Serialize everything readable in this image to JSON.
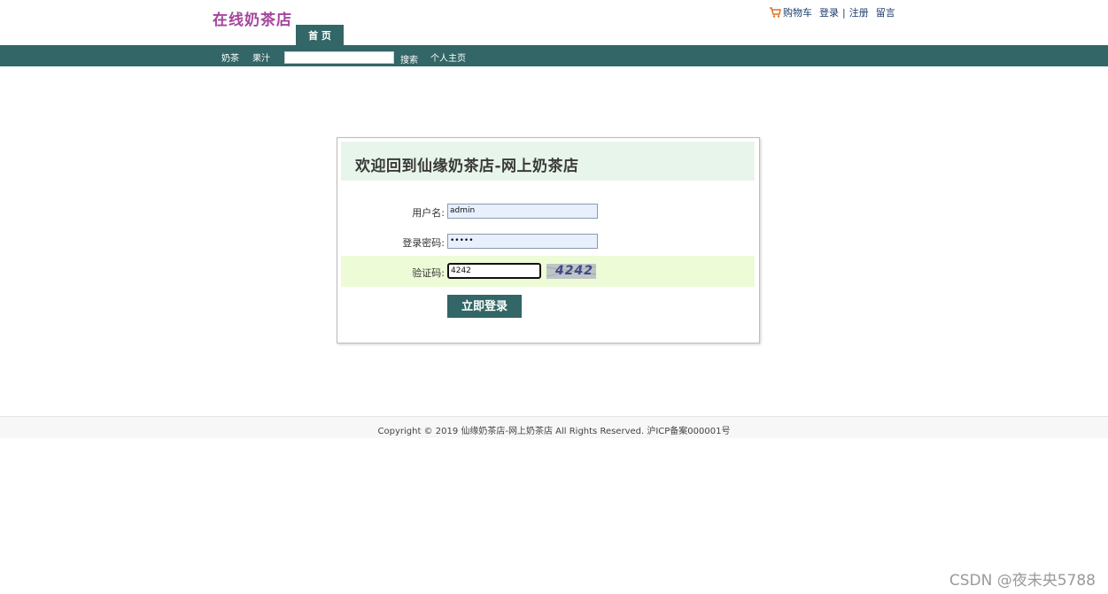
{
  "header": {
    "logo": "在线奶茶店",
    "links": {
      "cart": "购物车",
      "login": "登录",
      "separator": "|",
      "register": "注册",
      "message": "留言"
    },
    "home_tab": "首 页"
  },
  "nav": {
    "items": [
      "奶茶",
      "果汁"
    ],
    "search": {
      "value": "",
      "button": "搜索"
    },
    "profile": "个人主页"
  },
  "login": {
    "title": "欢迎回到仙缘奶茶店-网上奶茶店",
    "username_label": "用户名:",
    "username_value": "admin",
    "password_label": "登录密码:",
    "password_value": "•••••",
    "captcha_label": "验证码:",
    "captcha_value": "4242",
    "captcha_image_text": "4242",
    "submit": "立即登录"
  },
  "footer": {
    "text": "Copyright © 2019 仙缘奶茶店-网上奶茶店 All Rights Reserved. 沪ICP备案000001号"
  },
  "watermark": "CSDN @夜未央5788",
  "colors": {
    "nav_bg": "#336666",
    "logo": "#a4459c",
    "header_bg": "#e8f5ea",
    "captcha_row_bg": "#edfbd7"
  }
}
